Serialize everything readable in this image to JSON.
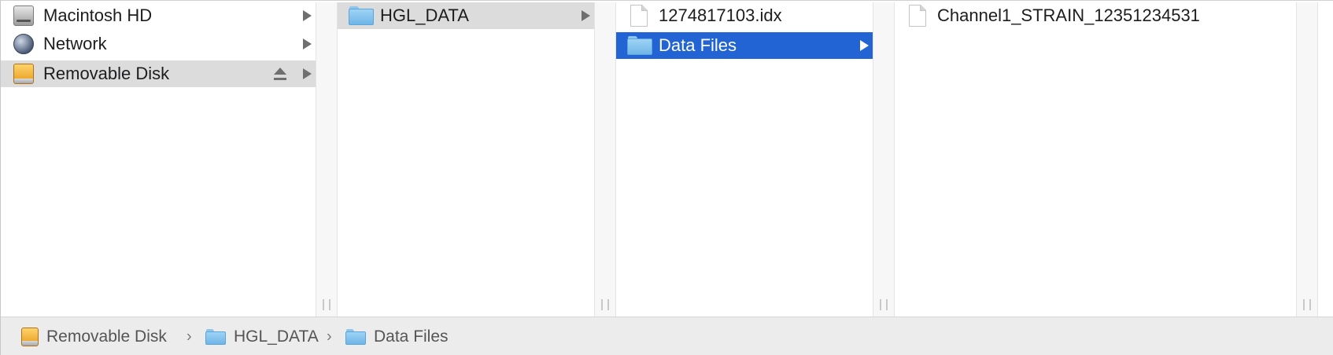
{
  "column1": {
    "items": [
      {
        "label": "Macintosh HD",
        "icon": "internal-disk-icon"
      },
      {
        "label": "Network",
        "icon": "network-globe-icon"
      },
      {
        "label": "Removable Disk",
        "icon": "removable-disk-icon",
        "selected": true,
        "ejectable": true
      }
    ]
  },
  "column2": {
    "items": [
      {
        "label": "HGL_DATA",
        "icon": "folder-icon",
        "selected": true
      }
    ]
  },
  "column3": {
    "items": [
      {
        "label": "1274817103.idx",
        "icon": "document-icon"
      },
      {
        "label": "Data Files",
        "icon": "folder-icon",
        "selected": true
      }
    ]
  },
  "column4": {
    "items": [
      {
        "label": "Channel1_STRAIN_12351234531",
        "icon": "document-icon"
      }
    ]
  },
  "pathbar": {
    "crumbs": [
      {
        "label": "Removable Disk",
        "icon": "removable-disk-icon"
      },
      {
        "label": "HGL_DATA",
        "icon": "folder-icon"
      },
      {
        "label": "Data Files",
        "icon": "folder-icon"
      }
    ],
    "separator": "›"
  },
  "colors": {
    "selection_blue": "#2364d4",
    "selection_grey": "#dcdcdc",
    "folder_blue": "#8cc6ec"
  }
}
